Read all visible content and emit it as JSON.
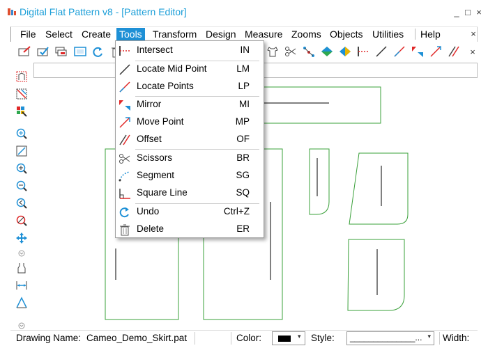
{
  "window": {
    "title": "Digital Flat Pattern v8 - [Pattern Editor]",
    "title_color": "#1a9ed8",
    "controls": [
      "_",
      "□",
      "×"
    ]
  },
  "menubar": {
    "items": [
      "File",
      "Select",
      "Create",
      "Tools",
      "Transform",
      "Design",
      "Measure",
      "Zooms",
      "Objects",
      "Utilities",
      "Help"
    ],
    "active": "Tools",
    "active_color": "#1e90d6"
  },
  "tools_menu": {
    "items": [
      {
        "label": "Intersect",
        "shortcut": "IN",
        "icon": "intersect-icon"
      },
      {
        "label": "Locate Mid Point",
        "shortcut": "LM",
        "icon": "locate-mid-point-icon"
      },
      {
        "label": "Locate Points",
        "shortcut": "LP",
        "icon": "locate-points-icon"
      },
      {
        "label": "Mirror",
        "shortcut": "MI",
        "icon": "mirror-icon"
      },
      {
        "label": "Move Point",
        "shortcut": "MP",
        "icon": "move-point-icon"
      },
      {
        "label": "Offset",
        "shortcut": "OF",
        "icon": "offset-icon"
      },
      {
        "label": "Scissors",
        "shortcut": "BR",
        "icon": "scissors-icon"
      },
      {
        "label": "Segment",
        "shortcut": "SG",
        "icon": "segment-icon"
      },
      {
        "label": "Square Line",
        "shortcut": "SQ",
        "icon": "square-line-icon"
      },
      {
        "label": "Undo",
        "shortcut": "Ctrl+Z",
        "icon": "undo-icon"
      },
      {
        "label": "Delete",
        "shortcut": "ER",
        "icon": "delete-icon"
      }
    ]
  },
  "statusbar": {
    "drawing_name_label": "Drawing Name:",
    "drawing_name": "Cameo_Demo_Skirt.pat",
    "color_label": "Color:",
    "color_value": "#000000",
    "style_label": "Style:",
    "style_value": "______________...",
    "width_label": "Width:"
  },
  "colors": {
    "pattern_outline": "#3aa03a",
    "icon_blue": "#1e90d6",
    "icon_red": "#e02828"
  }
}
